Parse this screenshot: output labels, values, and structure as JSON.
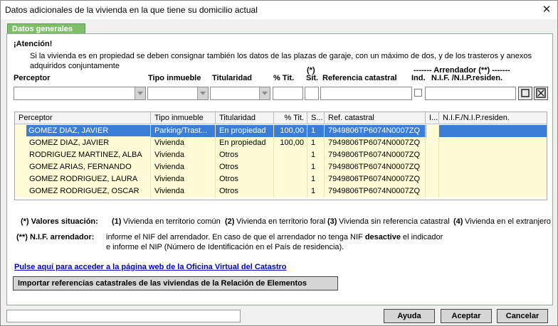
{
  "window": {
    "title": "Datos adicionales de la vivienda en la que tiene su domicilio actual",
    "close_glyph": "✕"
  },
  "tab": {
    "label": "Datos generales"
  },
  "attention": {
    "heading": "¡Atención!",
    "line1": "Si la vivienda es en propiedad se deben consignar también los datos de las plazas de garaje, con un máximo de dos, y de los trasteros y anexos",
    "line2": "adquiridos conjuntamente"
  },
  "form_headers": {
    "perceptor": "Perceptor",
    "tipo_inmueble": "Tipo inmueble",
    "titularidad": "Titularidad",
    "pct_tit": "% Tit.",
    "sit_note": "(*)",
    "sit": "Sit.",
    "ref_catastral": "Referencia catastral",
    "arrendador_top": "------- Arrendador (**) -------",
    "ind": "Ind.",
    "nif": "N.I.F. /N.I.P.residen."
  },
  "grid": {
    "columns": [
      "Perceptor",
      "Tipo inmueble",
      "Titularidad",
      "% Tit.",
      "S...",
      "Ref. catastral",
      "I...",
      "N.I.F./N.I.P.residen."
    ],
    "rows": [
      [
        "GOMEZ  DIAZ, JAVIER",
        "Parking/Trast...",
        "En propiedad",
        "100,00",
        "1",
        "7949806TP6074N0007ZQ",
        "",
        ""
      ],
      [
        "GOMEZ  DIAZ, JAVIER",
        "Vivienda",
        "En propiedad",
        "100,00",
        "1",
        "7949806TP6074N0007ZQ",
        "",
        ""
      ],
      [
        "RODRIGUEZ MARTINEZ, ALBA",
        "Vivienda",
        "Otros",
        "",
        "1",
        "7949806TP6074N0007ZQ",
        "",
        ""
      ],
      [
        "GOMEZ ARIAS, FERNANDO",
        "Vivienda",
        "Otros",
        "",
        "1",
        "7949806TP6074N0007ZQ",
        "",
        ""
      ],
      [
        "GOMEZ RODRIGUEZ, LAURA",
        "Vivienda",
        "Otros",
        "",
        "1",
        "7949806TP6074N0007ZQ",
        "",
        ""
      ],
      [
        "GOMEZ RODRIGUEZ, OSCAR",
        "Vivienda",
        "Otros",
        "",
        "1",
        "7949806TP6074N0007ZQ",
        "",
        ""
      ]
    ]
  },
  "legend": {
    "valores_label": "(*) Valores situación:",
    "v1_num": "(1)",
    "v1": "Vivienda en territorio común",
    "v2_num": "(2)",
    "v2": "Vivienda en territorio foral",
    "v3_num": "(3)",
    "v3": "Vivienda sin referencia catastral",
    "v4_num": "(4)",
    "v4": "Vivienda en el extranjero",
    "nif_label": "(**) N.I.F. arrendador:",
    "nif_line1_a": "informe el NIF del arrendador. En caso de que el arrendador no tenga NIF ",
    "nif_line1_bold": "desactive",
    "nif_line1_b": " el indicador",
    "nif_line2": "e informe el NIP (Número de Identificación en el País de residencia)."
  },
  "link": {
    "text": "Pulse aquí para acceder a la página web de la Oficina Virtual del Catastro"
  },
  "import_button": {
    "label": "Importar referencias catastrales de las viviendas de la Relación de Elementos"
  },
  "buttons": {
    "help": "Ayuda",
    "accept": "Aceptar",
    "cancel": "Cancelar"
  },
  "colors": {
    "selection": "#3a7dd8",
    "row_bg": "#fffbd6",
    "tab_green": "#7fbf6a"
  }
}
